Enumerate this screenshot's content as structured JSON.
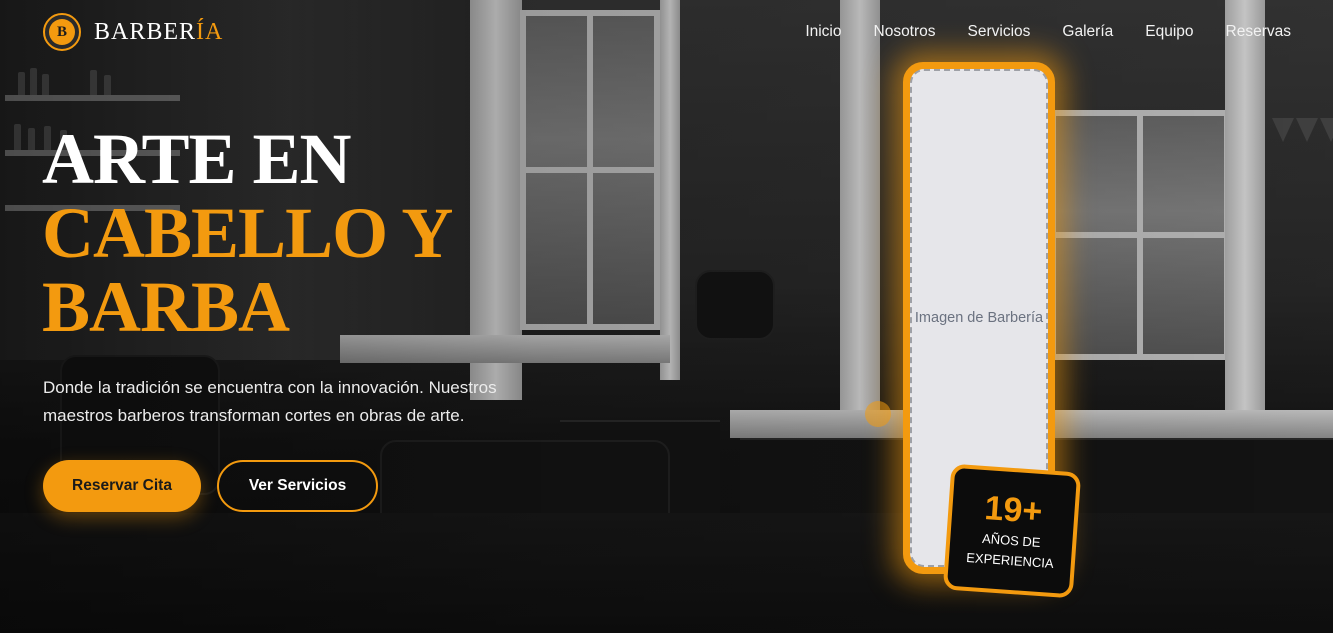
{
  "brand": {
    "name_main": "BARBER",
    "name_accent": "ÍA",
    "badge_letter": "B"
  },
  "nav": [
    {
      "label": "Inicio"
    },
    {
      "label": "Nosotros"
    },
    {
      "label": "Servicios"
    },
    {
      "label": "Galería"
    },
    {
      "label": "Equipo"
    },
    {
      "label": "Reservas"
    }
  ],
  "hero": {
    "title_line1": "ARTE EN",
    "title_line2": "CABELLO Y",
    "title_line3": "BARBA",
    "description": "Donde la tradición se encuentra con la innovación. Nuestros maestros barberos transforman cortes en obras de arte.",
    "primary_button": "Reservar Cita",
    "secondary_button": "Ver Servicios"
  },
  "image_card": {
    "placeholder": "Imagen de Barbería"
  },
  "experience_badge": {
    "number": "19+",
    "label_line1": "AÑOS DE",
    "label_line2": "EXPERIENCIA"
  },
  "colors": {
    "accent": "#f39a0f",
    "background": "#1a1a1a",
    "text": "#ffffff"
  }
}
